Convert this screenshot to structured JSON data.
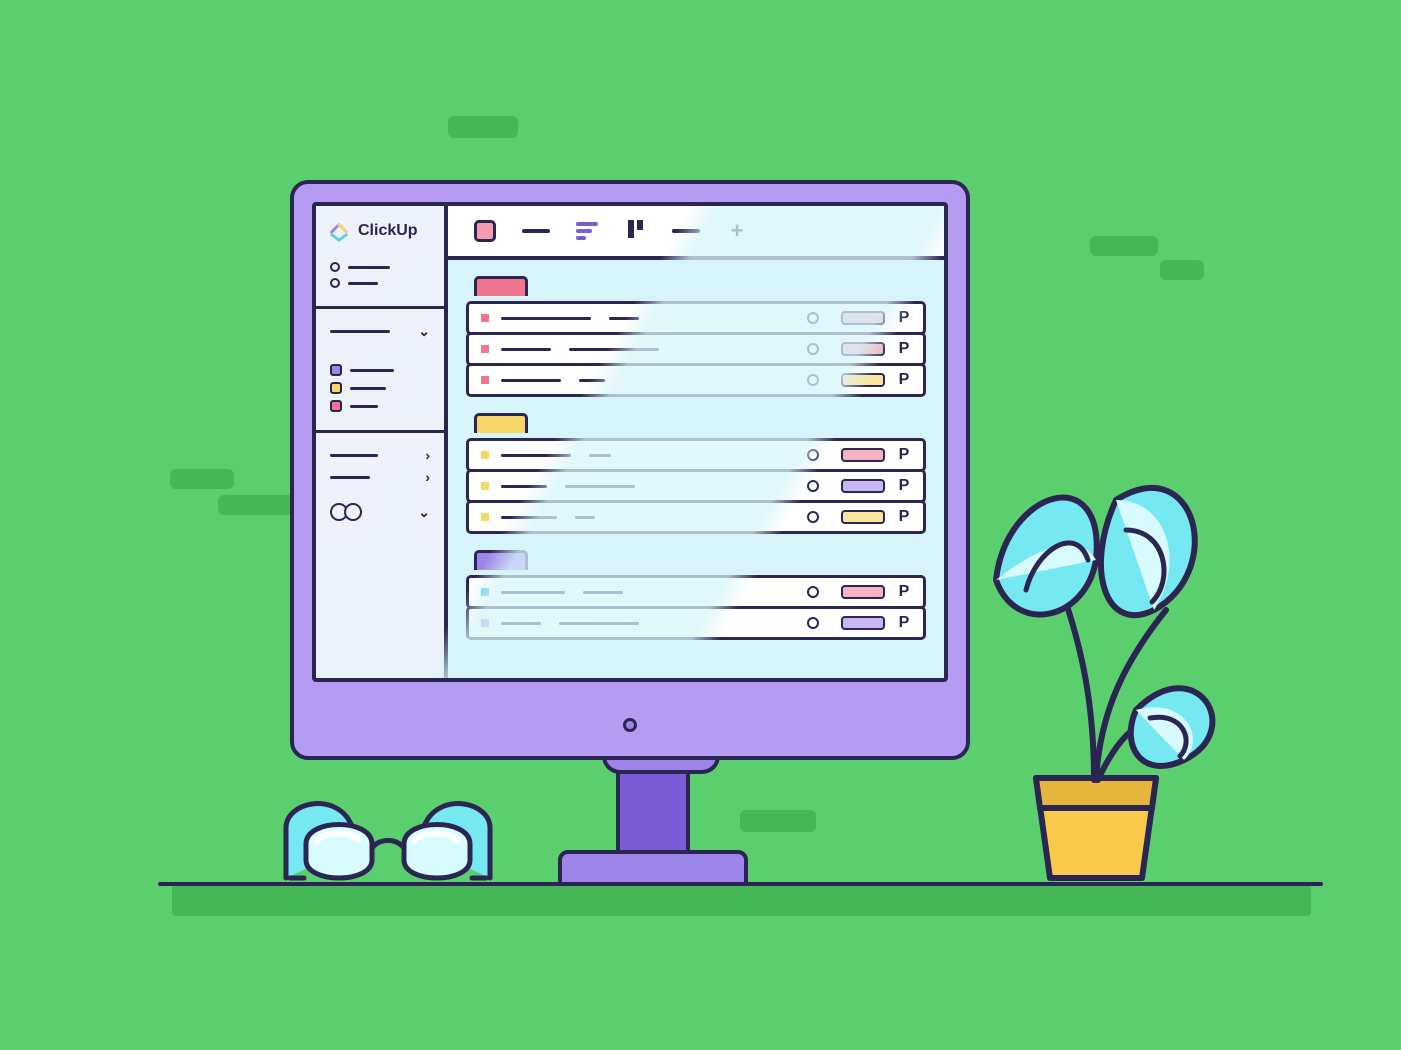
{
  "brand": "ClickUp",
  "flag_label": "P",
  "colors": {
    "pink": "#F0768F",
    "yellow": "#F8D568",
    "purple": "#9D84E8",
    "green_bg": "#5BCF6D",
    "cyan": "#5BCBE8"
  },
  "sidebar": {
    "quick_items": 2,
    "colored_items": [
      "purple",
      "yellow",
      "pink"
    ]
  },
  "tabs": [
    "square",
    "dash",
    "bars",
    "columns",
    "dash",
    "plus"
  ],
  "groups": [
    {
      "tag_color": "pink",
      "rows": [
        {
          "dot": "pink",
          "pill": "pk"
        },
        {
          "dot": "pink",
          "pill": "pk"
        },
        {
          "dot": "pink",
          "pill": "yl"
        }
      ]
    },
    {
      "tag_color": "yellow",
      "rows": [
        {
          "dot": "yellow",
          "pill": "pk"
        },
        {
          "dot": "yellow",
          "pill": "pr"
        },
        {
          "dot": "yellow",
          "pill": "yl"
        }
      ]
    },
    {
      "tag_color": "purple",
      "rows": [
        {
          "dot": "blue",
          "pill": "pk"
        },
        {
          "dot": "purple",
          "pill": "pr"
        }
      ]
    }
  ]
}
